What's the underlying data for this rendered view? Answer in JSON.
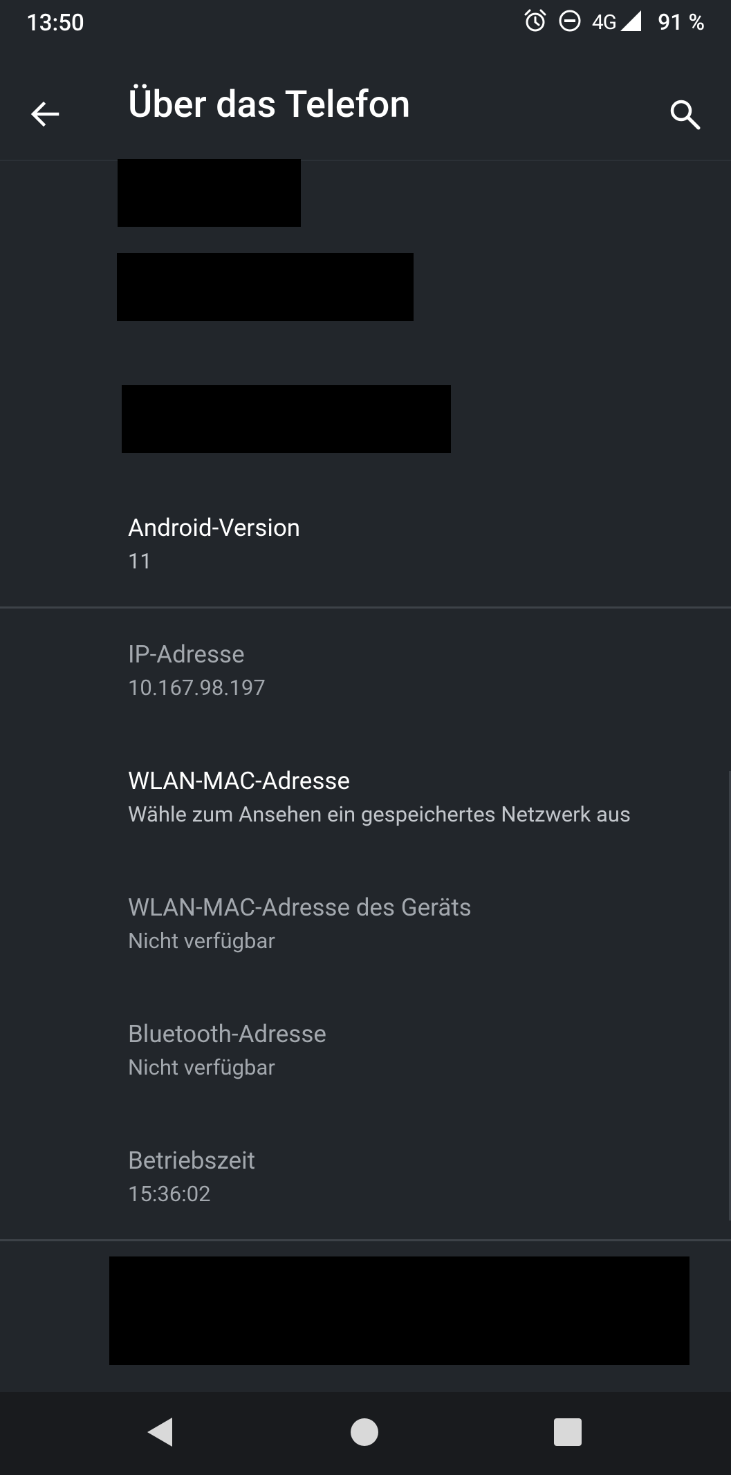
{
  "status_bar": {
    "time": "13:50",
    "network": "4G",
    "battery": "91 %",
    "icons": [
      "alarm-icon",
      "do-not-disturb-icon",
      "signal-icon"
    ]
  },
  "app_bar": {
    "title": "Über das Telefon",
    "back_icon": "arrow-back-icon",
    "search_icon": "search-icon"
  },
  "items": [
    {
      "title": "Android-Version",
      "subtitle": "11",
      "enabled": true
    },
    {
      "title": "IP-Adresse",
      "subtitle": "10.167.98.197",
      "enabled": false
    },
    {
      "title": "WLAN-MAC-Adresse",
      "subtitle": "Wähle zum Ansehen ein gespeichertes Netzwerk aus",
      "enabled": true
    },
    {
      "title": "WLAN-MAC-Adresse des Geräts",
      "subtitle": "Nicht verfügbar",
      "enabled": false
    },
    {
      "title": "Bluetooth-Adresse",
      "subtitle": "Nicht verfügbar",
      "enabled": false
    },
    {
      "title": "Betriebszeit",
      "subtitle": "15:36:02",
      "enabled": false
    }
  ],
  "nav_bar": {
    "back_icon": "nav-back-icon",
    "home_icon": "nav-home-icon",
    "recents_icon": "nav-recents-icon"
  },
  "colors": {
    "background": "#22262b",
    "nav_background": "#191b1e",
    "text_primary": "#ffffff",
    "text_secondary": "#c2c6cb",
    "text_disabled": "#a3a8ae",
    "redaction": "#000000"
  }
}
